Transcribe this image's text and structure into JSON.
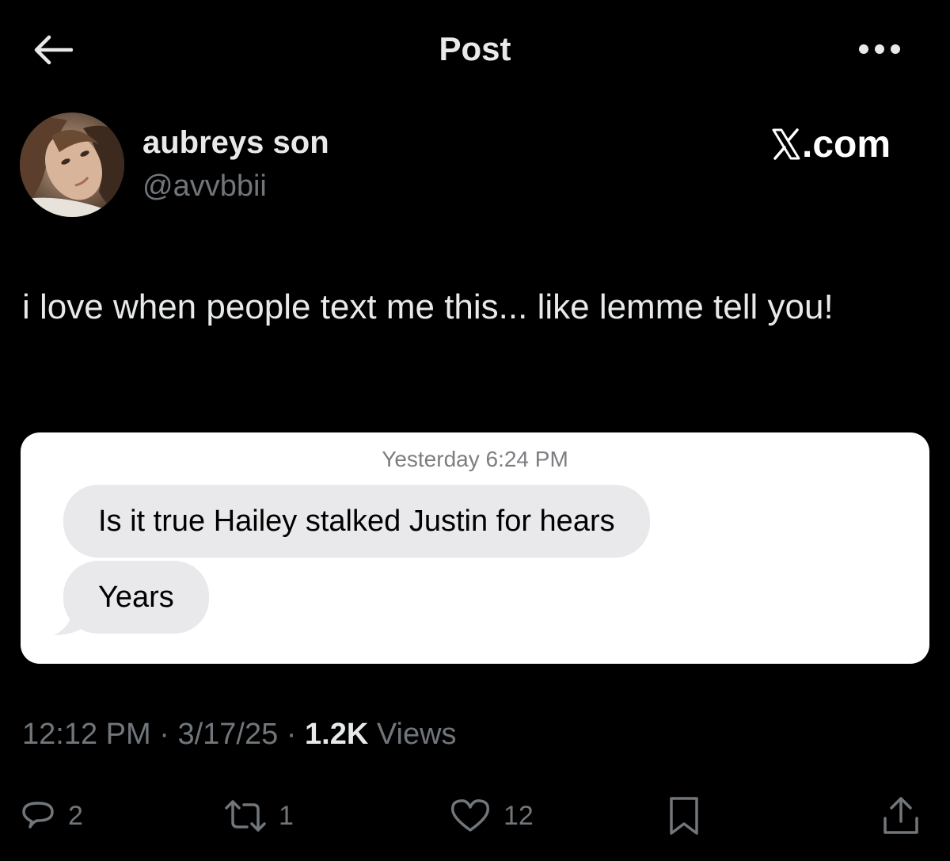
{
  "header": {
    "title": "Post",
    "back_icon": "arrow-left-icon",
    "more_icon": "more-horizontal-icon"
  },
  "author": {
    "display_name": "aubreys son",
    "handle": "@avvbbii"
  },
  "watermark": {
    "text": ".com",
    "logo": "X"
  },
  "post": {
    "text": "i love when people text me this... like lemme tell you!"
  },
  "screenshot_embed": {
    "timestamp": "Yesterday 6:24 PM",
    "messages": [
      "Is it true Hailey stalked Justin for hears",
      "Years"
    ]
  },
  "meta": {
    "time": "12:12 PM",
    "separator": "·",
    "date": "3/17/25",
    "views_count": "1.2K",
    "views_label": "Views"
  },
  "actions": {
    "replies": "2",
    "reposts": "1",
    "likes": "12"
  },
  "colors": {
    "background": "#000000",
    "primary_text": "#e7e9ea",
    "secondary_text": "#71767b",
    "bubble": "#e9e9eb"
  }
}
